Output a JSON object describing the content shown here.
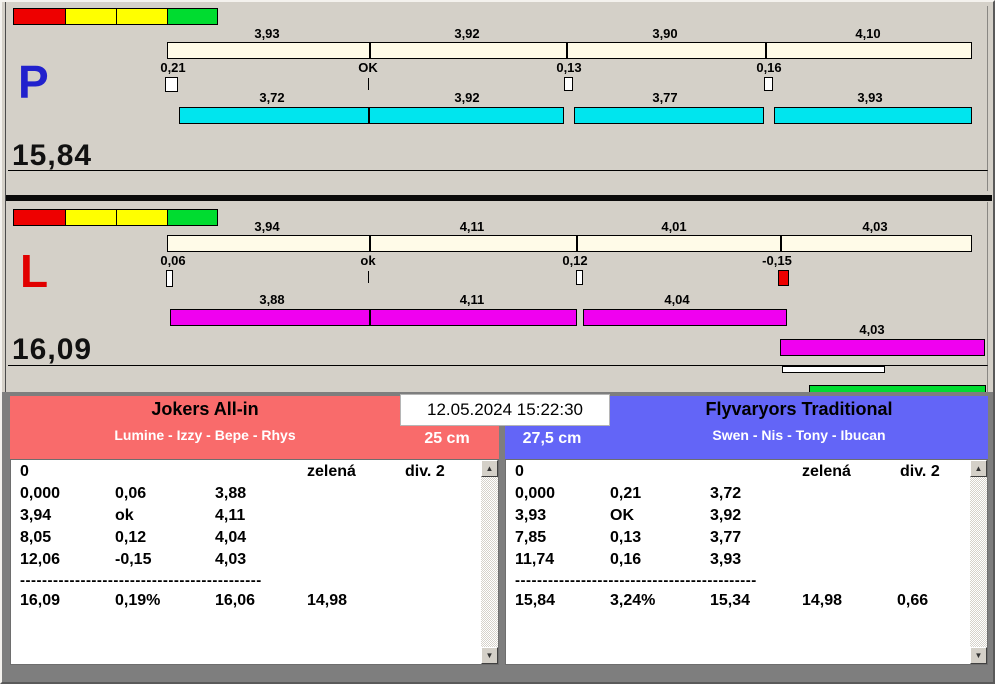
{
  "lane_p": {
    "letter": "P",
    "total": "15,84",
    "planned_segments": [
      "3,93",
      "3,92",
      "3,90",
      "4,10"
    ],
    "deviation_labels": [
      "0,21",
      "OK",
      "0,13",
      "0,16"
    ],
    "actual_segments": [
      "3,72",
      "3,92",
      "3,77",
      "3,93"
    ]
  },
  "lane_l": {
    "letter": "L",
    "total": "16,09",
    "planned_segments": [
      "3,94",
      "4,11",
      "4,01",
      "4,03"
    ],
    "deviation_labels": [
      "0,06",
      "ok",
      "0,12",
      "-0,15"
    ],
    "actual_segments": [
      "3,88",
      "4,11",
      "4,04"
    ],
    "pending_segment": "4,03"
  },
  "datetime": "12.05.2024 15:22:30",
  "team_left": {
    "name": "Jokers All-in",
    "players": "Lumine - Izzy - Bepe - Rhys",
    "handicap": "25 cm",
    "list": {
      "score": "0",
      "color": "zelená",
      "division": "div. 2",
      "rows": [
        [
          "0,000",
          "0,06",
          "3,88"
        ],
        [
          "3,94",
          "ok",
          "4,11"
        ],
        [
          "8,05",
          "0,12",
          "4,04"
        ],
        [
          "12,06",
          "-0,15",
          "4,03"
        ]
      ],
      "separator": "--------------------------------------------",
      "totals": [
        "16,09",
        "0,19%",
        "16,06",
        "14,98"
      ]
    }
  },
  "team_right": {
    "name": "Flyvaryors Traditional",
    "players": "Swen - Nis - Tony - Ibucan",
    "handicap": "27,5 cm",
    "list": {
      "score": "0",
      "color": "zelená",
      "division": "div. 2",
      "rows": [
        [
          "0,000",
          "0,21",
          "3,72"
        ],
        [
          "3,93",
          "OK",
          "3,92"
        ],
        [
          "7,85",
          "0,13",
          "3,77"
        ],
        [
          "11,74",
          "0,16",
          "3,93"
        ]
      ],
      "separator": "--------------------------------------------",
      "totals": [
        "15,84",
        "3,24%",
        "15,34",
        "14,98",
        "0,66"
      ]
    }
  },
  "scrollbar": {
    "up_glyph": "▲",
    "down_glyph": "▼"
  },
  "colors": {
    "background": "#d4d0c8",
    "planned_bar": "#FFFBE8",
    "p_actual_bar": "#00E5EE",
    "l_actual_bar": "#F000F0",
    "alert_red": "#EE0000",
    "go_green": "#00DC30",
    "team_left_bg": "#F96B6B",
    "team_right_bg": "#6365F7",
    "p_letter": "#2121CD",
    "l_letter": "#E10000"
  }
}
